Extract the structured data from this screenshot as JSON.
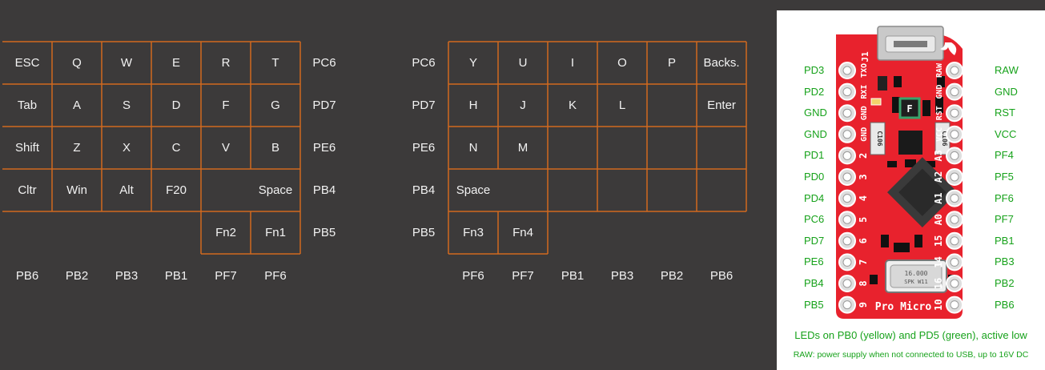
{
  "left_half": {
    "rows": [
      [
        "ESC",
        "Q",
        "W",
        "E",
        "R",
        "T"
      ],
      [
        "Tab",
        "A",
        "S",
        "D",
        "F",
        "G"
      ],
      [
        "Shift",
        "Z",
        "X",
        "C",
        "V",
        "B"
      ],
      [
        "Cltr",
        "Win",
        "Alt",
        "F20",
        "",
        "Space"
      ],
      [
        "",
        "",
        "",
        "",
        "Fn2",
        "Fn1"
      ]
    ],
    "row_pins": [
      "PC6",
      "PD7",
      "PE6",
      "PB4",
      "PB5"
    ],
    "col_pins": [
      "PB6",
      "PB2",
      "PB3",
      "PB1",
      "PF7",
      "PF6"
    ]
  },
  "right_half": {
    "rows": [
      [
        "Y",
        "U",
        "I",
        "O",
        "P",
        "Backs."
      ],
      [
        "H",
        "J",
        "K",
        "L",
        "",
        "Enter"
      ],
      [
        "N",
        "M",
        "",
        "",
        "",
        ""
      ],
      [
        "Space",
        "",
        "",
        "",
        "",
        ""
      ],
      [
        "Fn3",
        "Fn4",
        "",
        "",
        "",
        ""
      ]
    ],
    "row_pins": [
      "PC6",
      "PD7",
      "PE6",
      "PB4",
      "PB5"
    ],
    "col_pins": [
      "PF6",
      "PF7",
      "PB1",
      "PB3",
      "PB2",
      "PB6"
    ]
  },
  "pinout": {
    "left_pins": [
      "PD3",
      "PD2",
      "GND",
      "GND",
      "PD1",
      "PD0",
      "PD4",
      "PC6",
      "PD7",
      "PE6",
      "PB4",
      "PB5"
    ],
    "right_pins": [
      "RAW",
      "GND",
      "RST",
      "VCC",
      "PF4",
      "PF5",
      "PF6",
      "PF7",
      "PB1",
      "PB3",
      "PB2",
      "PB6"
    ],
    "board_left_silk": [
      "TXO",
      "RXI",
      "GND",
      "GND",
      "2",
      "3",
      "4",
      "5",
      "6",
      "7",
      "8",
      "9"
    ],
    "board_right_silk": [
      "RAW",
      "GND",
      "RST",
      "VCC",
      "A3",
      "A2",
      "A1",
      "A0",
      "15",
      "14",
      "16",
      "10"
    ],
    "board_name": "Pro Micro",
    "j1_label": "J1",
    "fuse_label": "F",
    "cap_label": "C106",
    "crystal_label": "16.000",
    "crystal_sub": "SPK W11",
    "note_leds": "LEDs on PB0 (yellow) and PD5 (green), active low",
    "note_raw": "RAW: power supply when not connected to USB, up to 16V DC"
  },
  "colors": {
    "background": "#3c3a3a",
    "grid_line": "#d2691e",
    "text": "#f2f2f2",
    "pin_label": "#17a21b",
    "board_red": "#e8222d"
  }
}
